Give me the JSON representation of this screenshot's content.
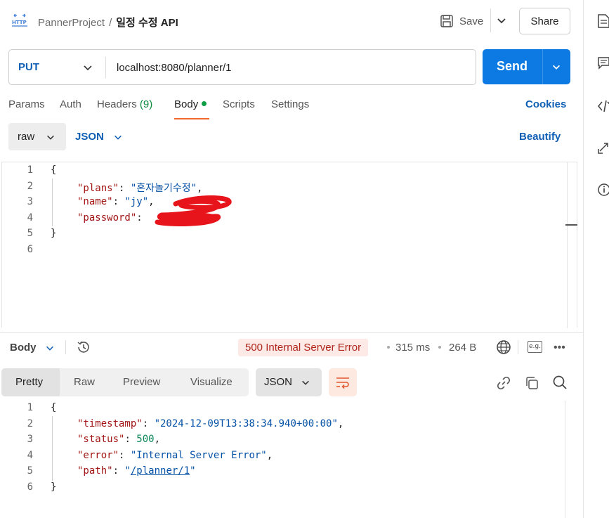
{
  "header": {
    "project": "PannerProject",
    "separator": "/",
    "request_name": "일정 수정 API",
    "save_label": "Save",
    "share_label": "Share"
  },
  "request": {
    "method": "PUT",
    "url": "localhost:8080/planner/1",
    "send_label": "Send"
  },
  "request_tabs": {
    "params": "Params",
    "auth": "Auth",
    "headers": "Headers",
    "headers_count": "(9)",
    "body": "Body",
    "scripts": "Scripts",
    "settings": "Settings",
    "cookies": "Cookies"
  },
  "body_toolbar": {
    "mode": "raw",
    "format": "JSON",
    "beautify": "Beautify"
  },
  "request_body": {
    "line_numbers": [
      "1",
      "2",
      "3",
      "4",
      "5",
      "6"
    ],
    "open_brace": "{",
    "close_brace": "}",
    "plans_key": "\"plans\"",
    "plans_value": "\"혼자놀기수정\"",
    "name_key": "\"name\"",
    "name_value": "\"jy\"",
    "password_key": "\"password\"",
    "password_value_hidden": "redacted"
  },
  "response_bar": {
    "body_label": "Body",
    "status": "500 Internal Server Error",
    "time": "315 ms",
    "size": "264 B",
    "eg_label": "e.g.",
    "status_color": "#b0261c"
  },
  "response_tabs": {
    "pretty": "Pretty",
    "raw": "Raw",
    "preview": "Preview",
    "visualize": "Visualize",
    "format": "JSON"
  },
  "response_body": {
    "line_numbers": [
      "1",
      "2",
      "3",
      "4",
      "5",
      "6"
    ],
    "open_brace": "{",
    "close_brace": "}",
    "timestamp_key": "\"timestamp\"",
    "timestamp_value": "\"2024-12-09T13:38:34.940+00:00\"",
    "status_key": "\"status\"",
    "status_value": "500",
    "error_key": "\"error\"",
    "error_value": "\"Internal Server Error\"",
    "path_key": "\"path\"",
    "path_value_q1": "\"",
    "path_value": "/planner/1",
    "path_value_q2": "\""
  },
  "colors": {
    "accent": "#0c7ae2",
    "active_tab_underline": "#f06a2f",
    "json_key": "#a31515",
    "json_string": "#0451a5",
    "json_number": "#098658"
  }
}
